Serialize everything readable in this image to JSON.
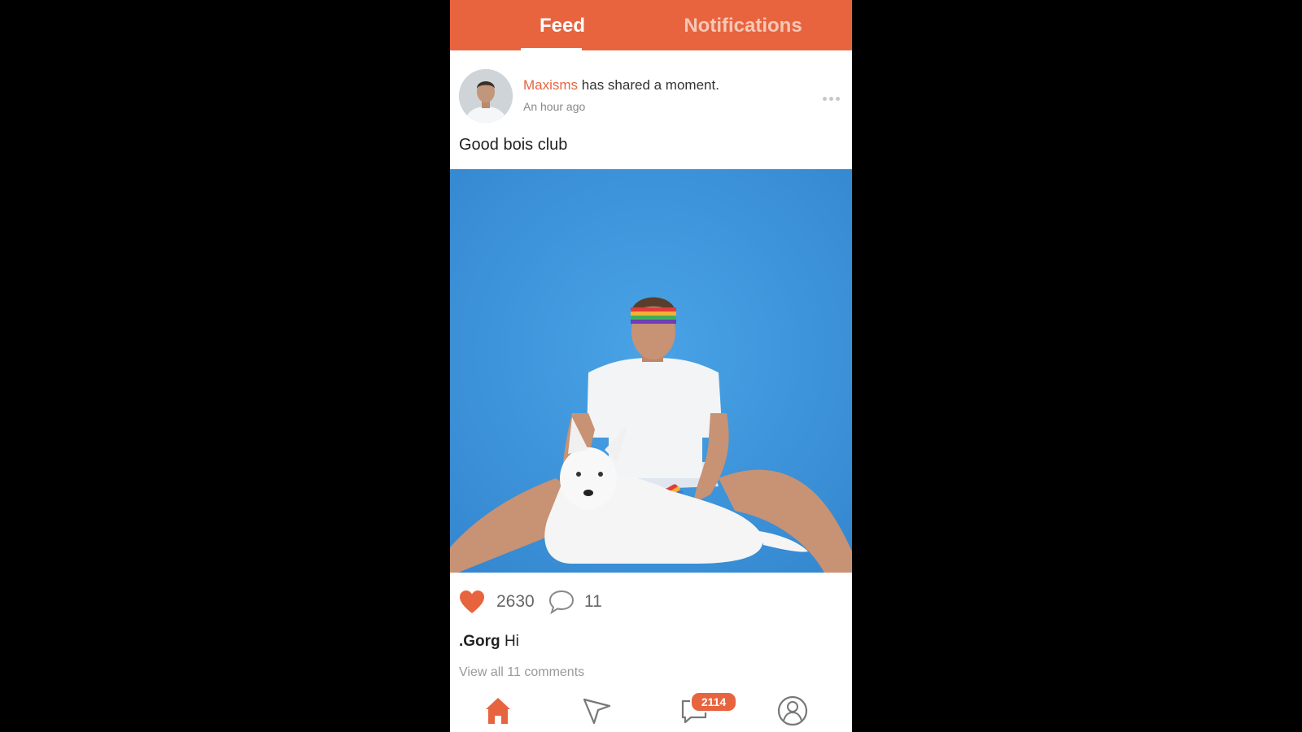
{
  "tabs": {
    "feed": "Feed",
    "notifications": "Notifications"
  },
  "post": {
    "author": "Maxisms",
    "action_text": " has shared a moment.",
    "timestamp": "An hour ago",
    "caption": "Good bois club",
    "likes": "2630",
    "comments_count": "11",
    "top_comment": {
      "user": ".Gorg",
      "text": "Hi"
    },
    "view_all_label": "View all 11 comments"
  },
  "nav": {
    "chat_badge": "2114",
    "icons": [
      "home-icon",
      "send-icon",
      "chat-icon",
      "profile-icon"
    ]
  },
  "colors": {
    "accent": "#E8643F",
    "photo_background": "#3E97DE"
  }
}
